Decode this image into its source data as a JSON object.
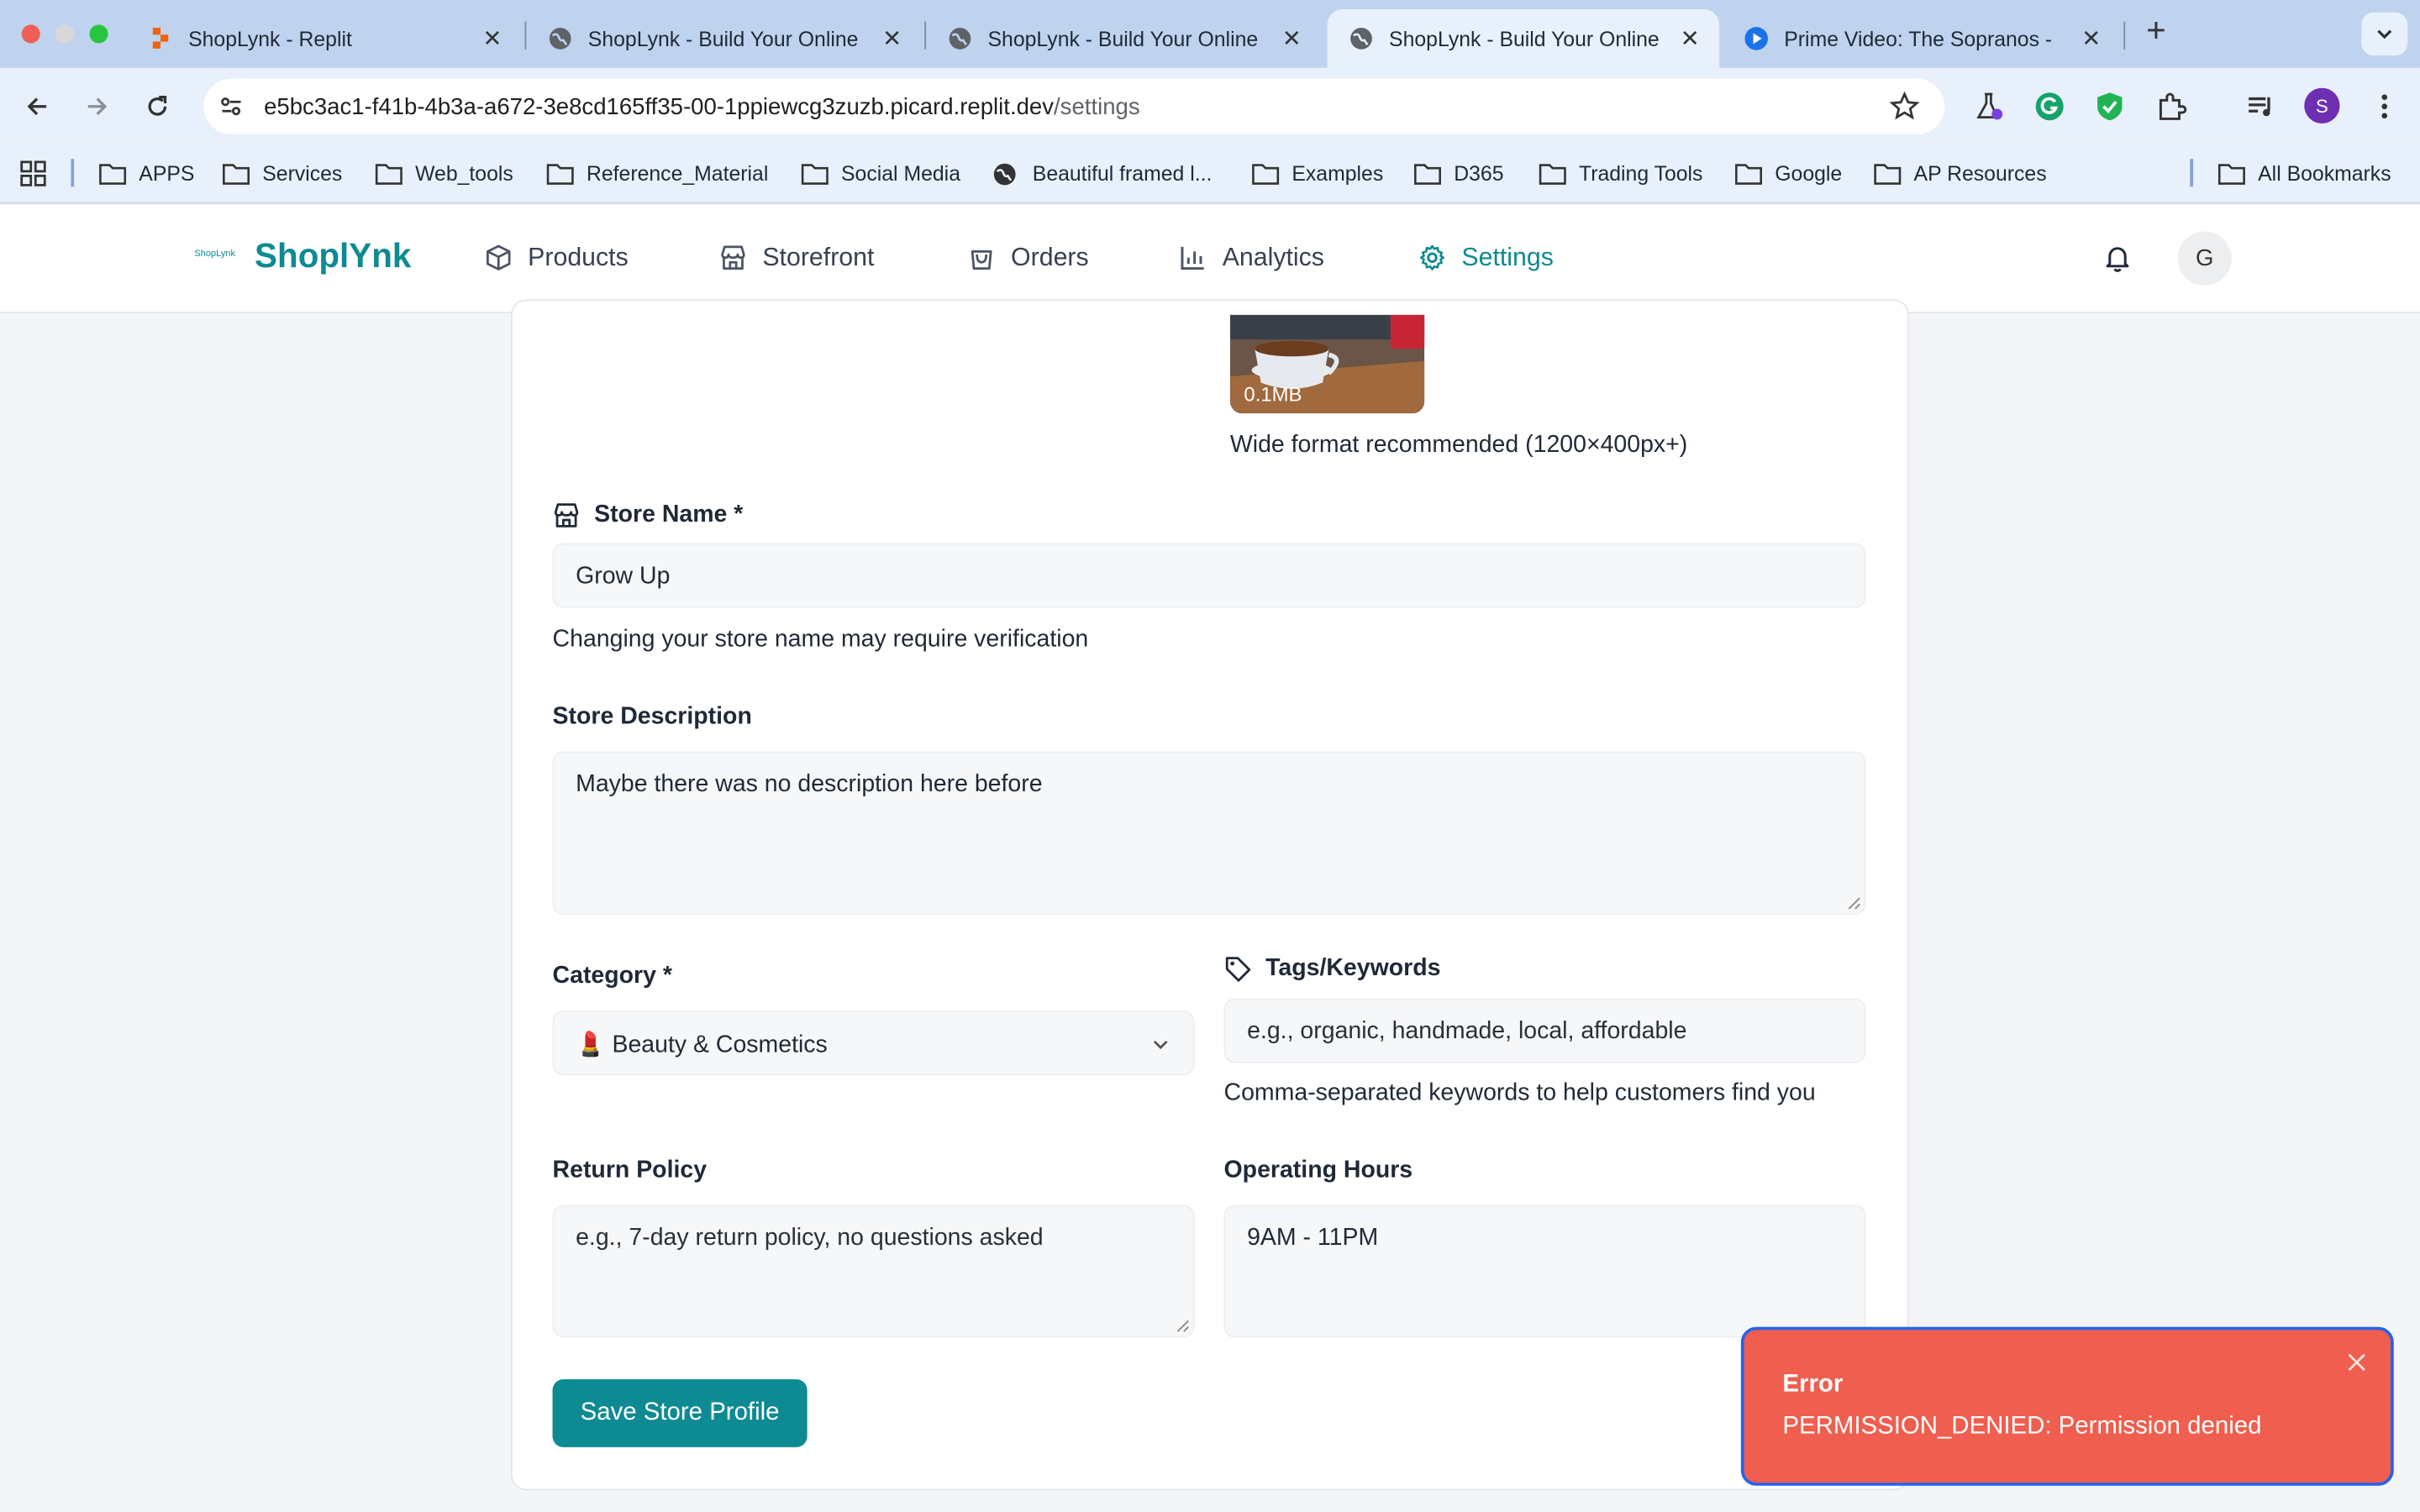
{
  "browser": {
    "tabs": [
      {
        "title": "ShopLynk - Replit",
        "favicon": "replit-icon"
      },
      {
        "title": "ShopLynk - Build Your Online",
        "favicon": "globe-icon"
      },
      {
        "title": "ShopLynk - Build Your Online",
        "favicon": "globe-icon"
      },
      {
        "title": "ShopLynk - Build Your Online",
        "favicon": "globe-icon"
      },
      {
        "title": "Prime Video: The Sopranos -",
        "favicon": "prime-video-icon"
      }
    ],
    "new_tab_label": "+",
    "url_host": "e5bc3ac1-f41b-4b3a-a672-3e8cd165ff35-00-1ppiewcg3zuzb.picard.replit.dev",
    "url_path": "/settings",
    "profile_initial": "S",
    "bookmarks": [
      "APPS",
      "Services",
      "Web_tools",
      "Reference_Material",
      "Social Media",
      "Beautiful framed l...",
      "Examples",
      "D365",
      "Trading Tools",
      "Google",
      "AP Resources"
    ],
    "all_bookmarks": "All Bookmarks"
  },
  "app": {
    "logo_small": "ShopLynk",
    "logo": "ShoplYnk",
    "nav": [
      "Products",
      "Storefront",
      "Orders",
      "Analytics",
      "Settings"
    ],
    "active_nav": "Settings",
    "avatar_initial": "G"
  },
  "form": {
    "banner_size": "0.1MB",
    "banner_hint": "Wide format recommended (1200×400px+)",
    "store_name_label": "Store Name *",
    "store_name_value": "Grow Up",
    "store_name_hint": "Changing your store name may require verification",
    "description_label": "Store Description",
    "description_value": "Maybe there was no description here before",
    "category_label": "Category *",
    "category_value": "💄 Beauty & Cosmetics",
    "tags_label": "Tags/Keywords",
    "tags_placeholder": "e.g., organic, handmade, local, affordable",
    "tags_hint": "Comma-separated keywords to help customers find you",
    "return_policy_label": "Return Policy",
    "return_policy_placeholder": "e.g., 7-day return policy, no questions asked",
    "hours_label": "Operating Hours",
    "hours_value": "9AM - 11PM",
    "save_button": "Save Store Profile"
  },
  "toast": {
    "title": "Error",
    "message": "PERMISSION_DENIED: Permission denied"
  },
  "colors": {
    "brand": "#0e8a93",
    "toast_bg": "#ef5e4e"
  }
}
